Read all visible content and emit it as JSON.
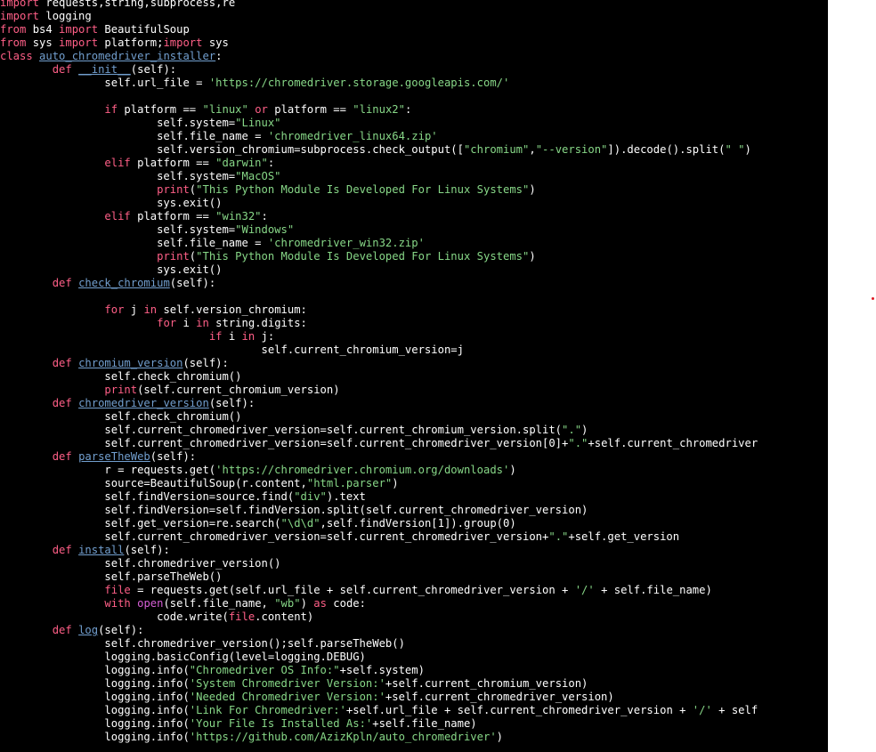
{
  "editor": {
    "background": "#000000",
    "colors": {
      "text": "#ffffff",
      "keyword": "#ff5f87",
      "function_name": "#729fcf",
      "string": "#87d787",
      "builtin": "#d75fd7",
      "marker": "#e01b24"
    },
    "lines": [
      [
        {
          "t": "import",
          "c": "kw"
        },
        {
          "t": " requests,string,subprocess,re"
        }
      ],
      [
        {
          "t": "import",
          "c": "kw"
        },
        {
          "t": " logging"
        }
      ],
      [
        {
          "t": "from",
          "c": "kw"
        },
        {
          "t": " bs4 "
        },
        {
          "t": "import",
          "c": "kw"
        },
        {
          "t": " BeautifulSoup"
        }
      ],
      [
        {
          "t": "from",
          "c": "kw"
        },
        {
          "t": " sys "
        },
        {
          "t": "import",
          "c": "kw"
        },
        {
          "t": " platform;"
        },
        {
          "t": "import",
          "c": "kw"
        },
        {
          "t": " sys"
        }
      ],
      [
        {
          "t": "class",
          "c": "kw"
        },
        {
          "t": " "
        },
        {
          "t": "auto_chromedriver_installer",
          "c": "fn"
        },
        {
          "t": ":"
        }
      ],
      [
        {
          "t": "        "
        },
        {
          "t": "def",
          "c": "kw"
        },
        {
          "t": " "
        },
        {
          "t": "__init__",
          "c": "fn"
        },
        {
          "t": "(self):"
        }
      ],
      [
        {
          "t": "                self.url_file = "
        },
        {
          "t": "'https://chromedriver.storage.googleapis.com/'",
          "c": "str"
        }
      ],
      [
        {
          "t": ""
        }
      ],
      [
        {
          "t": "                "
        },
        {
          "t": "if",
          "c": "kw"
        },
        {
          "t": " platform == "
        },
        {
          "t": "\"linux\"",
          "c": "str"
        },
        {
          "t": " "
        },
        {
          "t": "or",
          "c": "kw"
        },
        {
          "t": " platform == "
        },
        {
          "t": "\"linux2\"",
          "c": "str"
        },
        {
          "t": ":"
        }
      ],
      [
        {
          "t": "                        self.system="
        },
        {
          "t": "\"Linux\"",
          "c": "str"
        }
      ],
      [
        {
          "t": "                        self.file_name = "
        },
        {
          "t": "'chromedriver_linux64.zip'",
          "c": "str"
        }
      ],
      [
        {
          "t": "                        self.version_chromium=subprocess.check_output(["
        },
        {
          "t": "\"chromium\"",
          "c": "str"
        },
        {
          "t": ","
        },
        {
          "t": "\"--version\"",
          "c": "str"
        },
        {
          "t": "]).decode().split("
        },
        {
          "t": "\" \"",
          "c": "str"
        },
        {
          "t": ")"
        }
      ],
      [
        {
          "t": "                "
        },
        {
          "t": "elif",
          "c": "kw"
        },
        {
          "t": " platform == "
        },
        {
          "t": "\"darwin\"",
          "c": "str"
        },
        {
          "t": ":"
        }
      ],
      [
        {
          "t": "                        self.system="
        },
        {
          "t": "\"MacOS\"",
          "c": "str"
        }
      ],
      [
        {
          "t": "                        "
        },
        {
          "t": "print",
          "c": "kw"
        },
        {
          "t": "("
        },
        {
          "t": "\"This Python Module Is Developed For Linux Systems\"",
          "c": "str"
        },
        {
          "t": ")"
        }
      ],
      [
        {
          "t": "                        sys.exit()"
        }
      ],
      [
        {
          "t": "                "
        },
        {
          "t": "elif",
          "c": "kw"
        },
        {
          "t": " platform == "
        },
        {
          "t": "\"win32\"",
          "c": "str"
        },
        {
          "t": ":"
        }
      ],
      [
        {
          "t": "                        self.system="
        },
        {
          "t": "\"Windows\"",
          "c": "str"
        }
      ],
      [
        {
          "t": "                        self.file_name = "
        },
        {
          "t": "'chromedriver_win32.zip'",
          "c": "str"
        }
      ],
      [
        {
          "t": "                        "
        },
        {
          "t": "print",
          "c": "kw"
        },
        {
          "t": "("
        },
        {
          "t": "\"This Python Module Is Developed For Linux Systems\"",
          "c": "str"
        },
        {
          "t": ")"
        }
      ],
      [
        {
          "t": "                        sys.exit()"
        }
      ],
      [
        {
          "t": "        "
        },
        {
          "t": "def",
          "c": "kw"
        },
        {
          "t": " "
        },
        {
          "t": "check_chromium",
          "c": "fn"
        },
        {
          "t": "(self):"
        }
      ],
      [
        {
          "t": ""
        }
      ],
      [
        {
          "t": "                "
        },
        {
          "t": "for",
          "c": "kw"
        },
        {
          "t": " j "
        },
        {
          "t": "in",
          "c": "kw"
        },
        {
          "t": " self.version_chromium:"
        }
      ],
      [
        {
          "t": "                        "
        },
        {
          "t": "for",
          "c": "kw"
        },
        {
          "t": " i "
        },
        {
          "t": "in",
          "c": "kw"
        },
        {
          "t": " string.digits:"
        }
      ],
      [
        {
          "t": "                                "
        },
        {
          "t": "if",
          "c": "kw"
        },
        {
          "t": " i "
        },
        {
          "t": "in",
          "c": "kw"
        },
        {
          "t": " j:"
        }
      ],
      [
        {
          "t": "                                        self.current_chromium_version=j"
        }
      ],
      [
        {
          "t": "        "
        },
        {
          "t": "def",
          "c": "kw"
        },
        {
          "t": " "
        },
        {
          "t": "chromium_version",
          "c": "fn"
        },
        {
          "t": "(self):"
        }
      ],
      [
        {
          "t": "                self.check_chromium()"
        }
      ],
      [
        {
          "t": "                "
        },
        {
          "t": "print",
          "c": "kw"
        },
        {
          "t": "(self.current_chromium_version)"
        }
      ],
      [
        {
          "t": "        "
        },
        {
          "t": "def",
          "c": "kw"
        },
        {
          "t": " "
        },
        {
          "t": "chromedriver_version",
          "c": "fn"
        },
        {
          "t": "(self):"
        }
      ],
      [
        {
          "t": "                self.check_chromium()"
        }
      ],
      [
        {
          "t": "                self.current_chromedriver_version=self.current_chromium_version.split("
        },
        {
          "t": "\".\"",
          "c": "str"
        },
        {
          "t": ")"
        }
      ],
      [
        {
          "t": "                self.current_chromedriver_version=self.current_chromedriver_version[0]+"
        },
        {
          "t": "\".\"",
          "c": "str"
        },
        {
          "t": "+self.current_chromedriver"
        }
      ],
      [
        {
          "t": "        "
        },
        {
          "t": "def",
          "c": "kw"
        },
        {
          "t": " "
        },
        {
          "t": "parseTheWeb",
          "c": "fn"
        },
        {
          "t": "(self):"
        }
      ],
      [
        {
          "t": "                r = requests.get("
        },
        {
          "t": "'https://chromedriver.chromium.org/downloads'",
          "c": "str"
        },
        {
          "t": ")"
        }
      ],
      [
        {
          "t": "                source=BeautifulSoup(r.content,"
        },
        {
          "t": "\"html.parser\"",
          "c": "str"
        },
        {
          "t": ")"
        }
      ],
      [
        {
          "t": "                self.findVersion=source.find("
        },
        {
          "t": "\"div\"",
          "c": "str"
        },
        {
          "t": ").text"
        }
      ],
      [
        {
          "t": "                self.findVersion=self.findVersion.split(self.current_chromedriver_version)"
        }
      ],
      [
        {
          "t": "                self.get_version=re.search("
        },
        {
          "t": "\"\\d\\d\"",
          "c": "str"
        },
        {
          "t": ",self.findVersion[1]).group(0)"
        }
      ],
      [
        {
          "t": "                self.current_chromedriver_version=self.current_chromedriver_version+"
        },
        {
          "t": "\".\"",
          "c": "str"
        },
        {
          "t": "+self.get_version"
        }
      ],
      [
        {
          "t": "        "
        },
        {
          "t": "def",
          "c": "kw"
        },
        {
          "t": " "
        },
        {
          "t": "install",
          "c": "fn"
        },
        {
          "t": "(self):"
        }
      ],
      [
        {
          "t": "                self.chromedriver_version()"
        }
      ],
      [
        {
          "t": "                self.parseTheWeb()"
        }
      ],
      [
        {
          "t": "                "
        },
        {
          "t": "file",
          "c": "kw"
        },
        {
          "t": " = requests.get(self.url_file + self.current_chromedriver_version + "
        },
        {
          "t": "'/'",
          "c": "str"
        },
        {
          "t": " + self.file_name)"
        }
      ],
      [
        {
          "t": "                "
        },
        {
          "t": "with",
          "c": "kw"
        },
        {
          "t": " "
        },
        {
          "t": "open",
          "c": "bi"
        },
        {
          "t": "(self.file_name, "
        },
        {
          "t": "\"wb\"",
          "c": "str"
        },
        {
          "t": ") "
        },
        {
          "t": "as",
          "c": "kw"
        },
        {
          "t": " code:"
        }
      ],
      [
        {
          "t": "                        code.write("
        },
        {
          "t": "file",
          "c": "kw"
        },
        {
          "t": ".content)"
        }
      ],
      [
        {
          "t": "        "
        },
        {
          "t": "def",
          "c": "kw"
        },
        {
          "t": " "
        },
        {
          "t": "log",
          "c": "fn"
        },
        {
          "t": "(self):"
        }
      ],
      [
        {
          "t": "                self.chromedriver_version();self.parseTheWeb()"
        }
      ],
      [
        {
          "t": "                logging.basicConfig(level=logging.DEBUG)"
        }
      ],
      [
        {
          "t": "                logging.info("
        },
        {
          "t": "\"Chromedriver OS Info:\"",
          "c": "str"
        },
        {
          "t": "+self.system)"
        }
      ],
      [
        {
          "t": "                logging.info("
        },
        {
          "t": "'System Chromedriver Version:'",
          "c": "str"
        },
        {
          "t": "+self.current_chromium_version)"
        }
      ],
      [
        {
          "t": "                logging.info("
        },
        {
          "t": "'Needed Chromedriver Version:'",
          "c": "str"
        },
        {
          "t": "+self.current_chromedriver_version)"
        }
      ],
      [
        {
          "t": "                logging.info("
        },
        {
          "t": "'Link For Chromedriver:'",
          "c": "str"
        },
        {
          "t": "+self.url_file + self.current_chromedriver_version + "
        },
        {
          "t": "'/'",
          "c": "str"
        },
        {
          "t": " + self"
        }
      ],
      [
        {
          "t": "                logging.info("
        },
        {
          "t": "'Your File Is Installed As:'",
          "c": "str"
        },
        {
          "t": "+self.file_name)"
        }
      ],
      [
        {
          "t": "                logging.info("
        },
        {
          "t": "'https://github.com/AzizKpln/auto_chromedriver'",
          "c": "str"
        },
        {
          "t": ")"
        }
      ]
    ]
  }
}
